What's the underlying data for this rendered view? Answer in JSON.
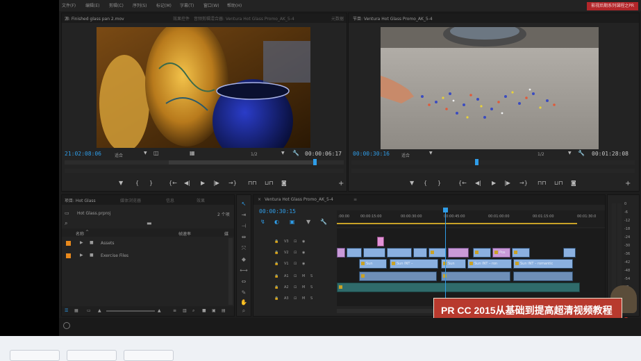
{
  "menu": [
    "文件(F)",
    "编辑(E)",
    "剪辑(C)",
    "序列(S)",
    "标记(M)",
    "字幕(T)",
    "窗口(W)",
    "帮助(H)"
  ],
  "channel_badge": "影视后期系列课程之PR",
  "source_monitor": {
    "tabs": [
      "源: Finished glass pan 2.mov",
      "效果控件",
      "音频剪辑混合器: Ventura Hot Glass Promo_AK_5-4",
      "元数据"
    ],
    "timecode_left": "21:02:08:06",
    "fit": "适合",
    "quality": "1/2",
    "timecode_right": "00:00:06:17"
  },
  "program_monitor": {
    "tab": "节目: Ventura Hot Glass Promo_AK_5-4",
    "timecode_left": "00:00:30:16",
    "fit": "适合",
    "quality": "1/2",
    "timecode_right": "00:01:28:08"
  },
  "transport_icons": [
    "marker-icon",
    "in-point-icon",
    "out-point-icon",
    "go-to-in-icon",
    "step-back-icon",
    "play-icon",
    "step-forward-icon",
    "go-to-out-icon",
    "insert-icon",
    "overwrite-icon",
    "export-frame-icon",
    "add-icon"
  ],
  "project_panel": {
    "tabs": [
      "项目: Hot Glass",
      "媒体浏览器",
      "信息",
      "效果"
    ],
    "project_file": "Hot Glass.prproj",
    "item_count": "2 个项",
    "col_name": "名称",
    "col_rate": "帧速率",
    "col_media": "媒",
    "items": [
      {
        "name": "Assets",
        "color": "#e8891c"
      },
      {
        "name": "Exercise Files",
        "color": "#e8891c"
      }
    ]
  },
  "timeline": {
    "tab": "Ventura Hot Glass Promo_AK_5-4",
    "timecode": "00:00:30:15",
    "ruler": [
      ":00:00",
      "00:00:15:00",
      "00:00:30:00",
      "00:00:45:00",
      "00:01:00:00",
      "00:01:15:00",
      "00:01:30:0"
    ],
    "tracks": [
      "V3",
      "V2",
      "V1",
      "A1",
      "A2",
      "A3"
    ],
    "clip_labels": {
      "pos": "Pos",
      "sun1": "Sun",
      "sun_int_1": "Sun INT –",
      "sun2": "Sun",
      "sun_int_2": "Sun INT – ron",
      "sun_int_romantic": "Sun INT – romantic"
    }
  },
  "audio_meter": {
    "scale": [
      "0",
      "-6",
      "-12",
      "-18",
      "-24",
      "-30",
      "-36",
      "-42",
      "-48",
      "-54",
      "dB"
    ]
  },
  "course_banner": "PR CC 2015从基础到提高超清视频教程",
  "colors": {
    "accent_blue": "#2f9de8",
    "clip_video": "#8ab0e0",
    "clip_video_pink": "#c99ad8",
    "clip_audio": "#2f6b6b",
    "banner_bg": "#b83a2e"
  }
}
